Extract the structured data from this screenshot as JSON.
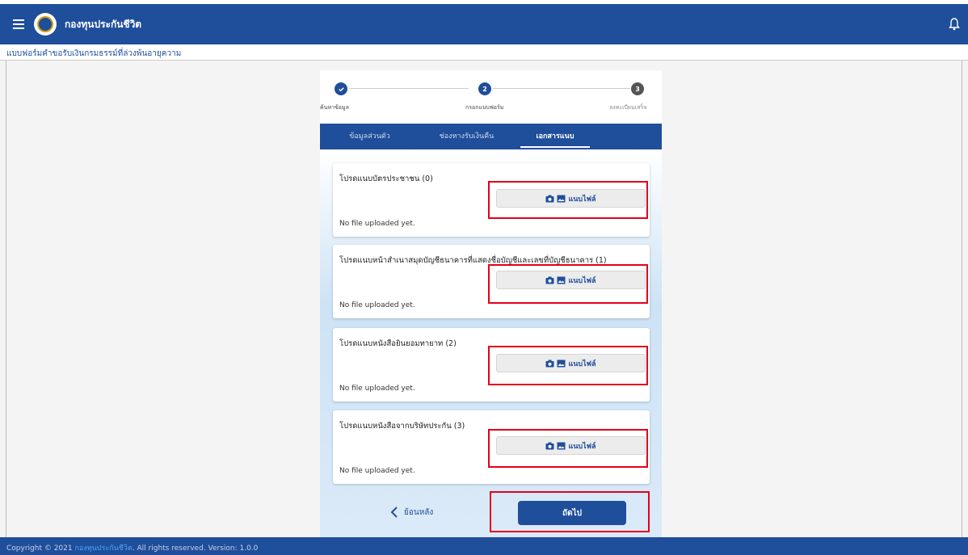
{
  "app": {
    "title": "กองทุนประกันชีวิต"
  },
  "breadcrumb": "แบบฟอร์มคำขอรับเงินกรมธรรม์ที่ล่วงพ้นอายุความ",
  "stepper": {
    "steps": [
      {
        "label": "ค้นหาข้อมูล",
        "number": "",
        "state": "done"
      },
      {
        "label": "กรอกแบบฟอร์ม",
        "number": "2",
        "state": "active"
      },
      {
        "label": "ลงทะเบียนเสร็จ",
        "number": "3",
        "state": "pending"
      }
    ]
  },
  "tabs": [
    {
      "label": "ข้อมูลส่วนตัว"
    },
    {
      "label": "ช่องทางรับเงินคืน"
    },
    {
      "label": "เอกสารแนบ"
    }
  ],
  "documents": [
    {
      "title": "โปรดแนบบัตรประชาชน (0)",
      "button": "แนบไฟล์",
      "status": "No file uploaded yet."
    },
    {
      "title": "โปรดแนบหน้าสำเนาสมุดบัญชีธนาคารที่แสดงชื่อบัญชีและเลขที่บัญชีธนาคาร (1)",
      "button": "แนบไฟล์",
      "status": "No file uploaded yet."
    },
    {
      "title": "โปรดแนบหนังสือยินยอมทายาท (2)",
      "button": "แนบไฟล์",
      "status": "No file uploaded yet."
    },
    {
      "title": "โปรดแนบหนังสือจากบริษัทประกัน (3)",
      "button": "แนบไฟล์",
      "status": "No file uploaded yet."
    }
  ],
  "actions": {
    "back": "ย้อนหลัง",
    "next": "ถัดไป"
  },
  "footer": {
    "prefix": "Copyright © 2021 ",
    "brand": "กองทุนประกันชีวิต",
    "suffix": ". All rights reserved. Version: 1.0.0"
  },
  "colors": {
    "primary": "#1f4e9b",
    "highlight": "#e3001b",
    "brand_link": "#4aa8ff"
  }
}
